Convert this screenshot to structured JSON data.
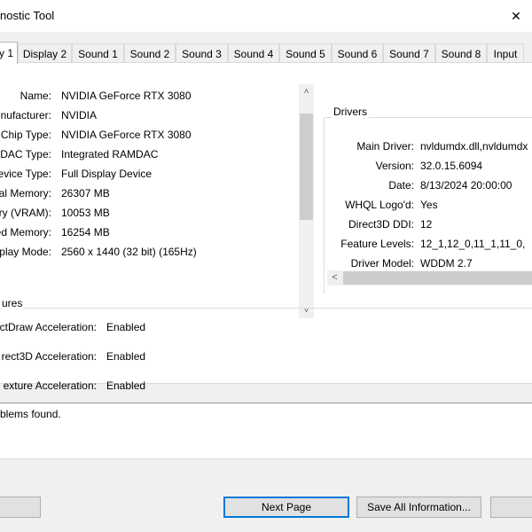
{
  "window": {
    "title": "nostic Tool",
    "close_glyph": "✕"
  },
  "tabs": [
    {
      "label": "y 1",
      "active": true
    },
    {
      "label": "Display 2"
    },
    {
      "label": "Sound 1"
    },
    {
      "label": "Sound 2"
    },
    {
      "label": "Sound 3"
    },
    {
      "label": "Sound 4"
    },
    {
      "label": "Sound 5"
    },
    {
      "label": "Sound 6"
    },
    {
      "label": "Sound 7"
    },
    {
      "label": "Sound 8"
    },
    {
      "label": "Input"
    }
  ],
  "device": {
    "rows": [
      {
        "label": "Name:",
        "value": "NVIDIA GeForce RTX 3080"
      },
      {
        "label": "nufacturer:",
        "value": "NVIDIA"
      },
      {
        "label": "Chip Type:",
        "value": "NVIDIA GeForce RTX 3080"
      },
      {
        "label": "DAC Type:",
        "value": "Integrated RAMDAC"
      },
      {
        "label": "evice Type:",
        "value": "Full Display Device"
      },
      {
        "label": "tal Memory:",
        "value": "26307 MB"
      },
      {
        "label": "ory (VRAM):",
        "value": "10053 MB"
      },
      {
        "label": "ed Memory:",
        "value": "16254 MB"
      },
      {
        "label": "splay Mode:",
        "value": "2560 x 1440 (32 bit) (165Hz)"
      }
    ],
    "scroll_up_glyph": "˄",
    "scroll_down_glyph": "˅"
  },
  "drivers": {
    "group_label": "Drivers",
    "rows": [
      {
        "label": "Main Driver:",
        "value": "nvldumdx.dll,nvldumdx"
      },
      {
        "label": "Version:",
        "value": "32.0.15.6094"
      },
      {
        "label": "Date:",
        "value": "8/13/2024 20:00:00"
      },
      {
        "label": "WHQL Logo'd:",
        "value": "Yes"
      },
      {
        "label": "Direct3D DDI:",
        "value": "12"
      },
      {
        "label": "Feature Levels:",
        "value": "12_1,12_0,11_1,11_0,"
      },
      {
        "label": "Driver Model:",
        "value": "WDDM 2.7"
      }
    ],
    "scroll_left_glyph": "<"
  },
  "features": {
    "group_label": "ures",
    "rows": [
      {
        "label": "ctDraw Acceleration:",
        "value": "Enabled"
      },
      {
        "label": "rect3D Acceleration:",
        "value": "Enabled"
      },
      {
        "label": "exture Acceleration:",
        "value": "Enabled"
      }
    ]
  },
  "notes": {
    "text": "blems found."
  },
  "buttons": {
    "help": "",
    "next_page": "Next Page",
    "save_all": "Save All Information...",
    "exit": ""
  }
}
